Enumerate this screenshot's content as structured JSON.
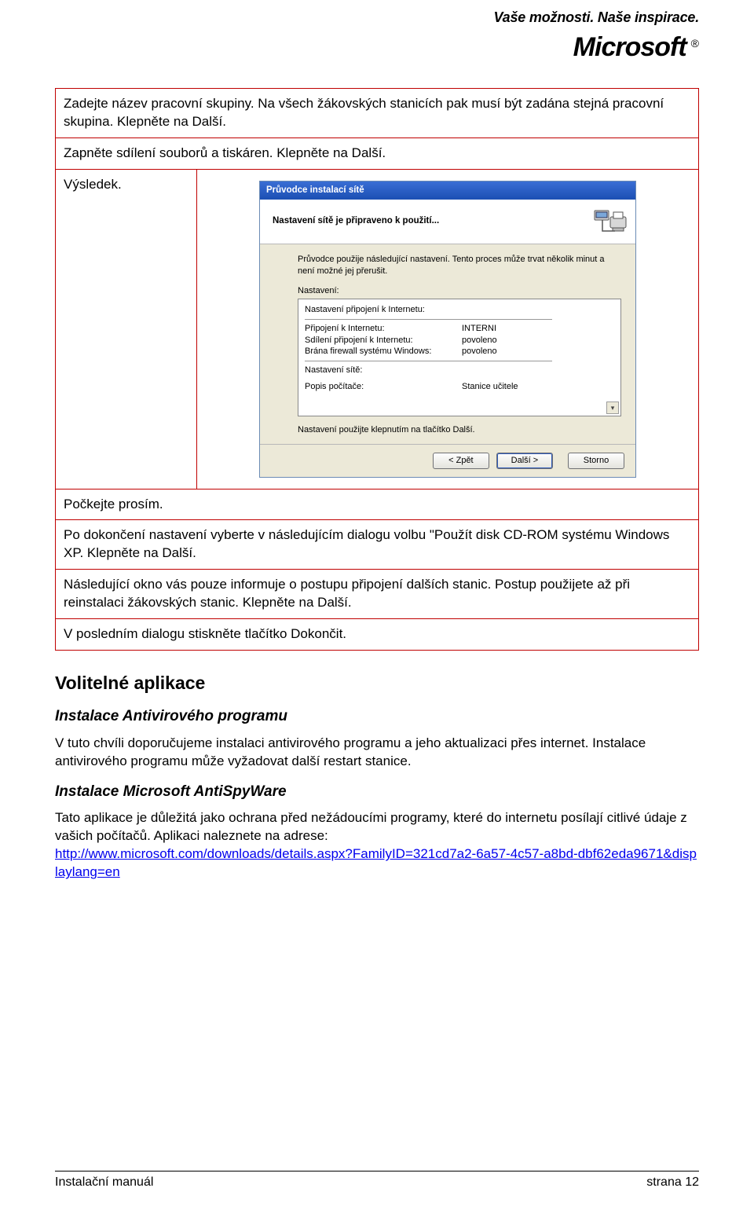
{
  "header": {
    "tagline": "Vaše možnosti. Naše inspirace.",
    "logo_text": "Microsoft"
  },
  "rows": {
    "r1": "Zadejte název pracovní skupiny. Na všech žákovských stanicích pak musí být zadána stejná pracovní skupina. Klepněte na Další.",
    "r2": "Zapněte sdílení souborů a tiskáren. Klepněte na Další.",
    "r3_label": "Výsledek.",
    "r4": "Počkejte prosím.",
    "r5": "Po dokončení nastavení vyberte v následujícím dialogu volbu \"Použít disk CD-ROM systému Windows XP. Klepněte na Další.",
    "r6": "Následující okno vás pouze informuje o postupu připojení dalších stanic. Postup použijete až při reinstalaci žákovských stanic. Klepněte na Další.",
    "r7": "V posledním dialogu stiskněte tlačítko Dokončit."
  },
  "wizard": {
    "title": "Průvodce instalací sítě",
    "heading": "Nastavení sítě je připraveno k použití...",
    "intro": "Průvodce použije následující nastavení. Tento proces může trvat několik minut a není možné jej přerušit.",
    "settings_label": "Nastavení:",
    "group1_title": "Nastavení připojení k Internetu:",
    "kv": [
      {
        "k": "Připojení k Internetu:",
        "v": "INTERNI"
      },
      {
        "k": "Sdílení připojení k Internetu:",
        "v": "povoleno"
      },
      {
        "k": "Brána firewall systému Windows:",
        "v": "povoleno"
      }
    ],
    "group2_title": "Nastavení sítě:",
    "kv2": [
      {
        "k": "Popis počítače:",
        "v": "Stanice učitele"
      }
    ],
    "note": "Nastavení použijte klepnutím na tlačítko Další.",
    "buttons": {
      "back": "< Zpět",
      "next": "Další >",
      "cancel": "Storno"
    }
  },
  "sections": {
    "volitelne": "Volitelné aplikace",
    "av_title": "Instalace Antivirového programu",
    "av_body": "V tuto chvíli doporučujeme instalaci antivirového programu a jeho aktualizaci přes internet. Instalace antivirového programu může vyžadovat další restart stanice.",
    "asw_title": "Instalace Microsoft AntiSpyWare",
    "asw_body": "Tato aplikace je důležitá jako ochrana před nežádoucími programy, které do internetu posílají citlivé údaje z vašich počítačů. Aplikaci naleznete na adrese:",
    "asw_link": "http://www.microsoft.com/downloads/details.aspx?FamilyID=321cd7a2-6a57-4c57-a8bd-dbf62eda9671&displaylang=en"
  },
  "footer": {
    "left": "Instalační manuál",
    "right": "strana 12"
  }
}
